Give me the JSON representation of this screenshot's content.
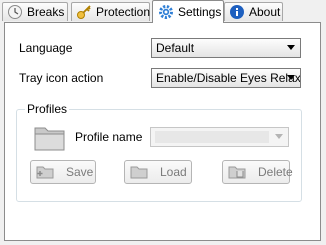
{
  "tabs": [
    {
      "label": "Breaks",
      "icon": "clock-icon"
    },
    {
      "label": "Protection",
      "icon": "key-icon"
    },
    {
      "label": "Settings",
      "icon": "gear-icon"
    },
    {
      "label": "About",
      "icon": "info-icon"
    }
  ],
  "settings": {
    "language_label": "Language",
    "language_value": "Default",
    "tray_label": "Tray icon action",
    "tray_value": "Enable/Disable Eyes Relax"
  },
  "profiles": {
    "title": "Profiles",
    "name_label": "Profile name",
    "name_value": "",
    "save_label": "Save",
    "load_label": "Load",
    "delete_label": "Delete"
  },
  "colors": {
    "active_tab_bg": "#ffffff",
    "disabled_text": "#7b7b7b",
    "info_blue": "#1d5fbf",
    "gear_blue": "#2f7fd6"
  }
}
